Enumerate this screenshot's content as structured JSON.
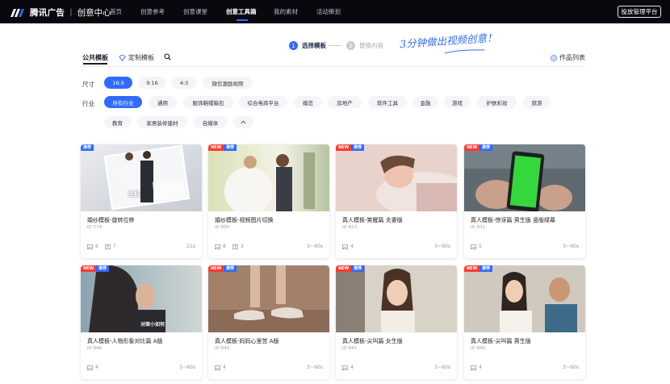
{
  "topbar": {
    "brand": "腾讯广告",
    "brand_sub": "创意中心",
    "nav": [
      {
        "label": "首页"
      },
      {
        "label": "创意参考"
      },
      {
        "label": "创意课堂"
      },
      {
        "label": "创意工具箱",
        "active": true
      },
      {
        "label": "我的素材"
      },
      {
        "label": "活动策划"
      }
    ],
    "ad_platform": "投放管理平台"
  },
  "steps": [
    {
      "num": "1",
      "label": "选择模板"
    },
    {
      "num": "2",
      "label": "替换内容"
    }
  ],
  "slogan": "3分钟做出视频创意！",
  "tabs": [
    {
      "label": "公共模板"
    },
    {
      "label": "定制模板"
    }
  ],
  "works_list": "作品列表",
  "filters": {
    "size_label": "尺寸",
    "sizes": [
      "16:9",
      "9:16",
      "4:3",
      "微信激励视频"
    ],
    "industry_label": "行业",
    "industries_row1": [
      "所有行业",
      "通用",
      "服饰鞋帽箱包",
      "综合电商平台",
      "婚恋",
      "房地产",
      "软件工具",
      "金融",
      "游戏",
      "护肤彩妆",
      "旅游"
    ],
    "industries_row2": [
      "教育",
      "家居装修建材",
      "自媒体"
    ]
  },
  "badges": {
    "new": "NEW",
    "rec": "推荐"
  },
  "cards": [
    {
      "title": "婚纱模板-旋转位移",
      "id": "ID 779",
      "images": "6",
      "texts": "7",
      "duration": "21s",
      "overlay": "主标",
      "new": false
    },
    {
      "title": "婚纱模板-视频图片切换",
      "id": "ID 850",
      "images": "8",
      "texts": "3",
      "duration": "5~60s",
      "overlay": "",
      "new": true
    },
    {
      "title": "真人模板-笑醒篇 夫妻版",
      "id": "ID 823",
      "images": "4",
      "texts": "",
      "duration": "5~60s",
      "overlay": "",
      "new": true
    },
    {
      "title": "真人模板-惊讶篇 男生版 竖版绿幕",
      "id": "ID 832",
      "images": "5",
      "texts": "",
      "duration": "5~60s",
      "overlay": "",
      "new": true
    },
    {
      "title": "真人模板-人物形象对比篇 A版",
      "id": "ID 846",
      "images": "4",
      "texts": "",
      "duration": "5~60s",
      "overlay": "对面小如何",
      "new": true
    },
    {
      "title": "真人模板-妈妈心里苦 A版",
      "id": "ID 844",
      "images": "4",
      "texts": "",
      "duration": "5~60s",
      "overlay": "",
      "new": true
    },
    {
      "title": "真人模板-尖叫篇 女生版",
      "id": "ID 841",
      "images": "4",
      "texts": "",
      "duration": "5~60s",
      "overlay": "",
      "new": true
    },
    {
      "title": "真人模板-尖叫篇 男生版",
      "id": "ID 840",
      "images": "4",
      "texts": "",
      "duration": "5~60s",
      "overlay": "",
      "new": true
    }
  ]
}
